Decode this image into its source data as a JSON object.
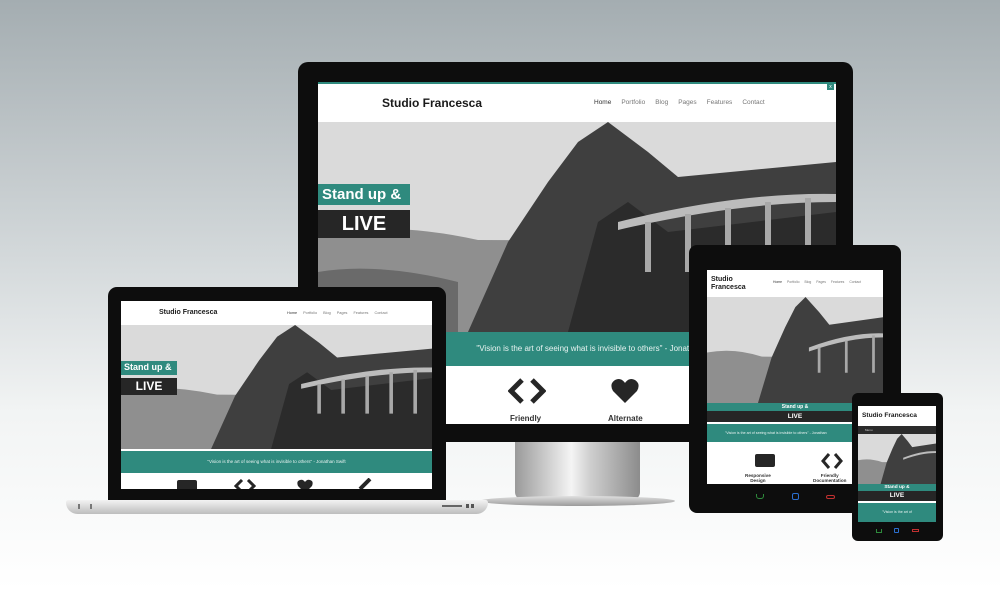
{
  "site": {
    "logo": "Studio Francesca",
    "logo_line1": "Studio",
    "logo_line2": "Francesca",
    "nav": [
      "Home",
      "Portfolio",
      "Blog",
      "Pages",
      "Features",
      "Contact"
    ],
    "mobile_menu": "Menu",
    "hero_line1": "Stand up &",
    "hero_line2": "LIVE",
    "quote": "\"Vision is the art of seeing what is invisible to others\" - Jonathan Swift",
    "quote_cut_desktop": "\"Vision is the art of seeing what is invisible to others\" - Jonathan Swi",
    "quote_cut_tablet": "\"Vision is the art of seeing what is invisible to others\" - Jonathan",
    "quote_cut_phone": "\"Vision is the art of",
    "features": [
      {
        "label": "Responsive Design",
        "label_cut": "e",
        "icon": "folder-icon"
      },
      {
        "label": "Friendly Documentation",
        "label_short": "Friendly",
        "icon": "code-icon"
      },
      {
        "label": "Alternate",
        "icon": "heart-icon"
      },
      {
        "label": "",
        "icon": "link-icon"
      }
    ],
    "tablet_feature_1": "Responsive\nDesign",
    "tablet_feature_2": "Friendly\nDocumentation"
  },
  "colors": {
    "accent": "#2f8a7e",
    "dark": "#262626",
    "device": "#0d0d0d"
  }
}
